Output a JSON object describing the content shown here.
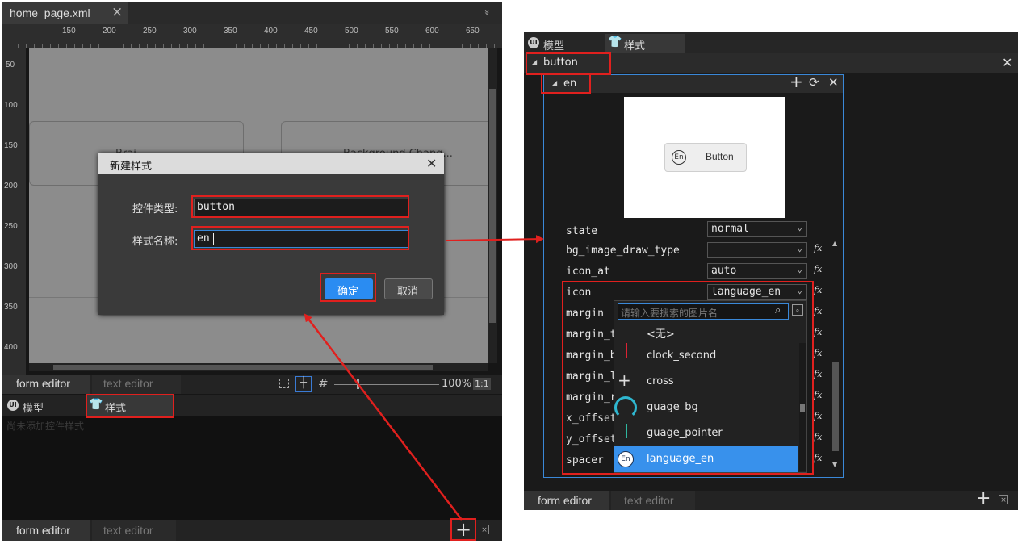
{
  "left": {
    "tab": {
      "title": "home_page.xml",
      "close": "×",
      "chevron": "»"
    },
    "ruler_top": [
      "150",
      "200",
      "250",
      "300",
      "350",
      "400",
      "450",
      "500",
      "550",
      "600",
      "650"
    ],
    "ruler_left": [
      "50",
      "100",
      "150",
      "200",
      "250",
      "300",
      "350",
      "400"
    ],
    "canvas": {
      "card1": "Brai...",
      "card2": "Background Chang..."
    },
    "dialog": {
      "title": "新建样式",
      "close": "✕",
      "type_label": "控件类型:",
      "type_value": "button",
      "name_label": "样式名称:",
      "name_value": "en",
      "ok": "确定",
      "cancel": "取消"
    },
    "editor_tabs": {
      "form": "form editor",
      "text": "text editor"
    },
    "zoom": "100%",
    "ratio": "1:1",
    "panel_tabs": {
      "model": "模型",
      "style": "样式"
    },
    "empty_hint": "尚未添加控件样式",
    "bottom_tabs": {
      "form": "form editor",
      "text": "text editor"
    },
    "add": "+"
  },
  "right": {
    "panel_tabs": {
      "model": "模型",
      "style": "样式"
    },
    "button_header": "button",
    "close": "✕",
    "en_header": "en",
    "preview_button": "Button",
    "preview_icon": "En",
    "props": [
      {
        "label": "state",
        "value": "normal"
      },
      {
        "label": "bg_image_draw_type",
        "value": ""
      },
      {
        "label": "icon_at",
        "value": "auto"
      },
      {
        "label": "icon",
        "value": "language_en"
      },
      {
        "label": "margin",
        "value": ""
      },
      {
        "label": "margin_to",
        "value": ""
      },
      {
        "label": "margin_bo",
        "value": ""
      },
      {
        "label": "margin_le",
        "value": ""
      },
      {
        "label": "margin_ri",
        "value": ""
      },
      {
        "label": "x_offset",
        "value": ""
      },
      {
        "label": "y_offset",
        "value": ""
      },
      {
        "label": "spacer",
        "value": ""
      }
    ],
    "fx": "fx",
    "search_placeholder": "请输入要搜索的图片名",
    "image_list": [
      "<无>",
      "clock_second",
      "cross",
      "guage_bg",
      "guage_pointer",
      "language_en"
    ],
    "editor_tabs": {
      "form": "form editor",
      "text": "text editor"
    },
    "add": "+"
  },
  "colors": {
    "accent": "#2a8cf2",
    "highlight": "#e0201e",
    "selected": "#3891ec"
  }
}
